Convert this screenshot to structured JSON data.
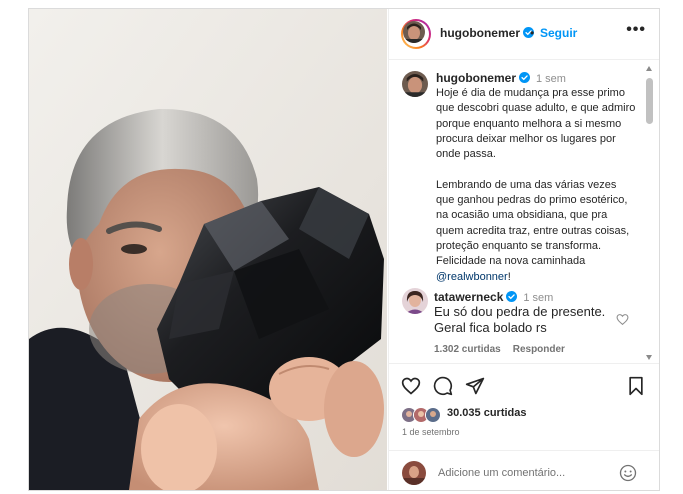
{
  "post": {
    "author": "hugobonemer",
    "follow_label": "Seguir",
    "dot": "•",
    "more": "•••"
  },
  "caption": {
    "username": "hugobonemer",
    "time": "1 sem",
    "text": "Hoje é dia de mudança pra esse primo que descobri quase adulto, e que admiro porque enquanto melhora a si mesmo procura deixar melhor os lugares por onde passa.\n\nLembrando de uma das várias vezes que ganhou pedras do primo esotérico,  na ocasião uma obsidiana, que pra quem acredita traz, entre outras coisas, proteção enquanto se transforma.  Felicidade na nova caminhada ",
    "mention": "@realwbonner",
    "end": "!"
  },
  "comment": {
    "username": "tatawerneck",
    "time": "1 sem",
    "text": "Eu só dou pedra de presente. Geral fica bolado rs",
    "likes": "1.302 curtidas",
    "reply": "Responder"
  },
  "stats": {
    "likes": "30.035 curtidas",
    "date": "1 de setembro"
  },
  "composer": {
    "placeholder": "Adicione um comentário..."
  },
  "icons": [
    "heart-icon",
    "comment-icon",
    "share-icon",
    "bookmark-icon",
    "verified-icon",
    "emoji-icon",
    "more-icon"
  ],
  "colors": {
    "link": "#0095f6",
    "mention": "#00376b",
    "verified": "#0095f6",
    "muted": "#737373"
  }
}
